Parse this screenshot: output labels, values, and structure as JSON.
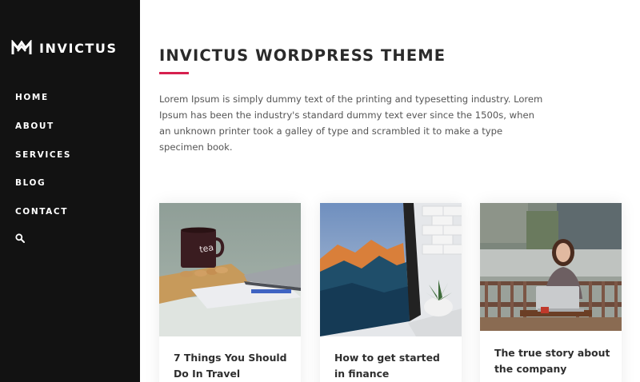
{
  "brand": {
    "name": "INVICTUS",
    "logo_icon": "invictus-m-logo-icon"
  },
  "nav": {
    "items": [
      {
        "label": "HOME"
      },
      {
        "label": "ABOUT"
      },
      {
        "label": "SERVICES"
      },
      {
        "label": "BLOG"
      },
      {
        "label": "CONTACT"
      }
    ],
    "search_icon": "search-icon"
  },
  "main": {
    "title": "INVICTUS WORDPRESS THEME",
    "intro": "Lorem Ipsum is simply dummy text of the printing and typesetting industry. Lorem Ipsum has been the industry's standard dummy text ever since the 1500s, when an unknown printer took a galley of type and scrambled it to make a type specimen book."
  },
  "posts": [
    {
      "title": "7 Things You Should Do In Travel",
      "image": "coffee-mug-desk-photo"
    },
    {
      "title": "How to get started in finance",
      "image": "monitor-mountain-wallpaper-photo"
    },
    {
      "title": "The true story about the company",
      "image": "woman-laptop-outdoor-photo"
    }
  ],
  "colors": {
    "sidebar_bg": "#121212",
    "accent": "#d6204e",
    "heading": "#2a2a2a",
    "body_text": "#555555"
  }
}
